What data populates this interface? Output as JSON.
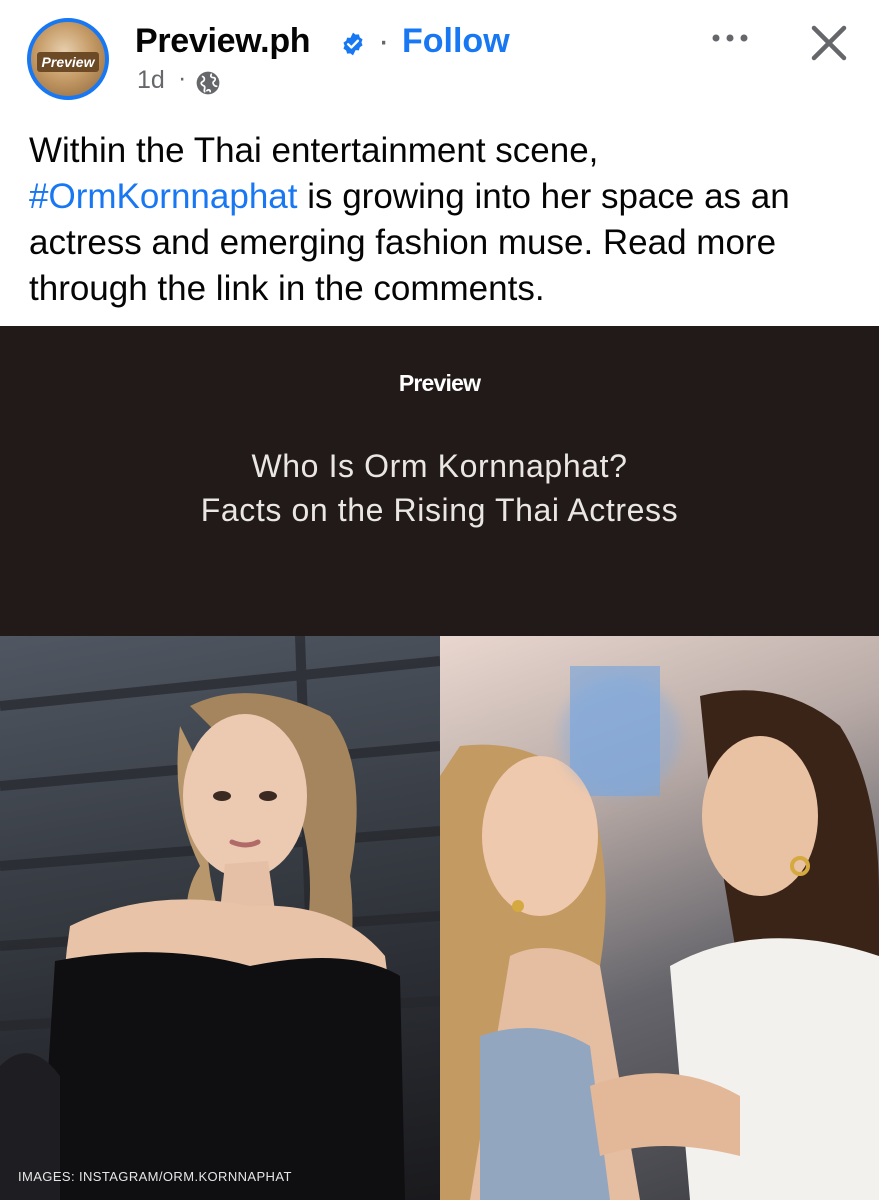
{
  "post": {
    "page_name": "Preview.ph",
    "avatar_text": "Preview",
    "separator": "·",
    "follow_label": "Follow",
    "timestamp": "1d",
    "timestamp_separator": "·",
    "caption_part1": "Within the Thai entertainment scene, ",
    "hashtag": "#OrmKornnaphat",
    "caption_part2": " is growing into her space as an actress and emerging fashion muse. Read more through the link in the comments."
  },
  "link_card": {
    "logo_text": "Preview",
    "title_line1": "Who Is Orm Kornnaphat?",
    "title_line2": "Facts on the Rising Thai Actress",
    "photo_credit": "IMAGES: INSTAGRAM/ORM.KORNNAPHAT"
  },
  "icons": {
    "verified": "verified-badge-icon",
    "privacy": "globe-icon",
    "more": "more-options-icon",
    "close": "close-icon"
  },
  "colors": {
    "accent": "#1877f2",
    "secondary_text": "#65676b",
    "card_background": "#221a18"
  }
}
